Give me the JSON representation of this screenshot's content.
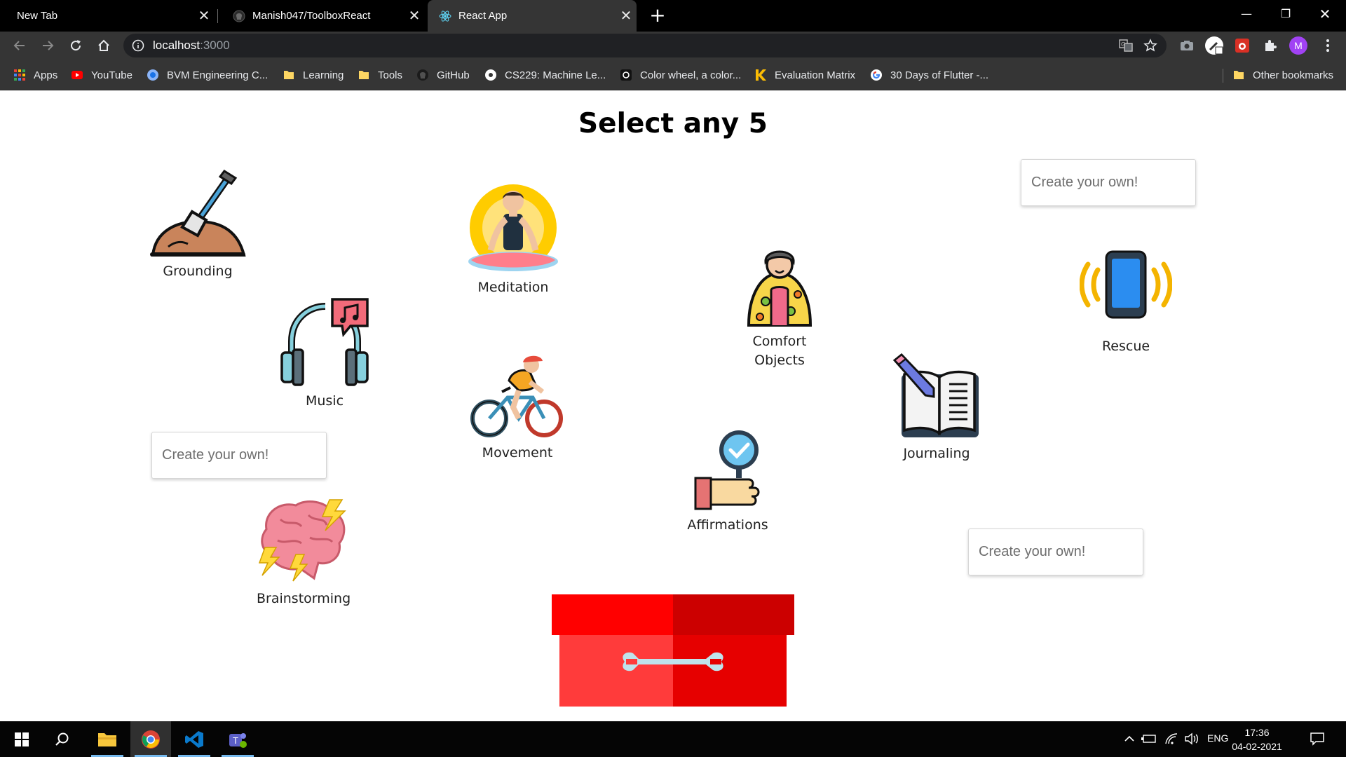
{
  "browser": {
    "tabs": [
      {
        "title": "New Tab",
        "active": false
      },
      {
        "title": "Manish047/ToolboxReact",
        "active": false
      },
      {
        "title": "React App",
        "active": true
      }
    ],
    "url_host": "localhost",
    "url_port": ":3000",
    "bookmarks": [
      {
        "label": "Apps",
        "icon": "apps-grid-icon"
      },
      {
        "label": "YouTube",
        "icon": "youtube-icon"
      },
      {
        "label": "BVM Engineering C...",
        "icon": "college-icon"
      },
      {
        "label": "Learning",
        "icon": "folder-icon"
      },
      {
        "label": "Tools",
        "icon": "folder-icon"
      },
      {
        "label": "GitHub",
        "icon": "github-icon"
      },
      {
        "label": "CS229: Machine Le...",
        "icon": "globe-icon"
      },
      {
        "label": "Color wheel, a color...",
        "icon": "adobe-color-icon"
      },
      {
        "label": "Evaluation Matrix",
        "icon": "k-logo-icon"
      },
      {
        "label": "30 Days of Flutter -...",
        "icon": "google-icon"
      }
    ],
    "other_bookmarks": "Other bookmarks",
    "profile_initial": "M"
  },
  "page": {
    "title": "Select any 5",
    "tools": {
      "grounding": "Grounding",
      "meditation": "Meditation",
      "music": "Music",
      "comfort": "Comfort Objects",
      "rescue": "Rescue",
      "movement": "Movement",
      "journaling": "Journaling",
      "affirmations": "Affirmations",
      "brainstorming": "Brainstorming"
    },
    "create_placeholder": "Create your own!"
  },
  "taskbar": {
    "lang": "ENG",
    "time": "17:36",
    "date": "04-02-2021"
  },
  "colors": {
    "chrome_dark": "#353535",
    "titlebar": "#000000",
    "toolbox_red": "#ff1a1a"
  }
}
